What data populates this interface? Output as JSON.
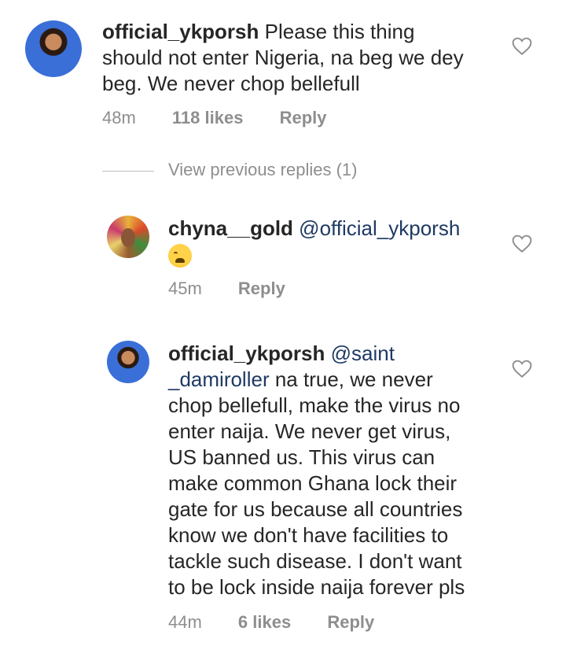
{
  "comments": [
    {
      "username": "official_ykporsh",
      "mention": "",
      "text_lines": [
        "Please this thing",
        "should not enter Nigeria, na beg we dey",
        "beg. We never chop bellefull"
      ],
      "time": "48m",
      "likes": "118 likes",
      "reply": "Reply"
    },
    {
      "username": "chyna__gold",
      "mention": "@official_ykporsh",
      "emoji": "weary-face",
      "time": "45m",
      "reply": "Reply"
    },
    {
      "username": "official_ykporsh",
      "mention_part1": "@saint",
      "mention_part2": "_damiroller",
      "text_lines": [
        " na true, we never",
        "chop bellefull, make the virus no",
        "enter naija. We never get virus,",
        "US banned us. This virus can",
        "make common Ghana lock their",
        "gate for us because all countries",
        "know we don't have facilities to",
        "tackle such disease. I don't want",
        "to be lock inside naija forever pls"
      ],
      "time": "44m",
      "likes": "6 likes",
      "reply": "Reply"
    }
  ],
  "view_previous": "View previous replies (1)",
  "icons": {
    "heart": "heart-outline-icon"
  },
  "colors": {
    "text": "#262626",
    "meta": "#8e8e8e",
    "mention": "#1f3a63"
  }
}
